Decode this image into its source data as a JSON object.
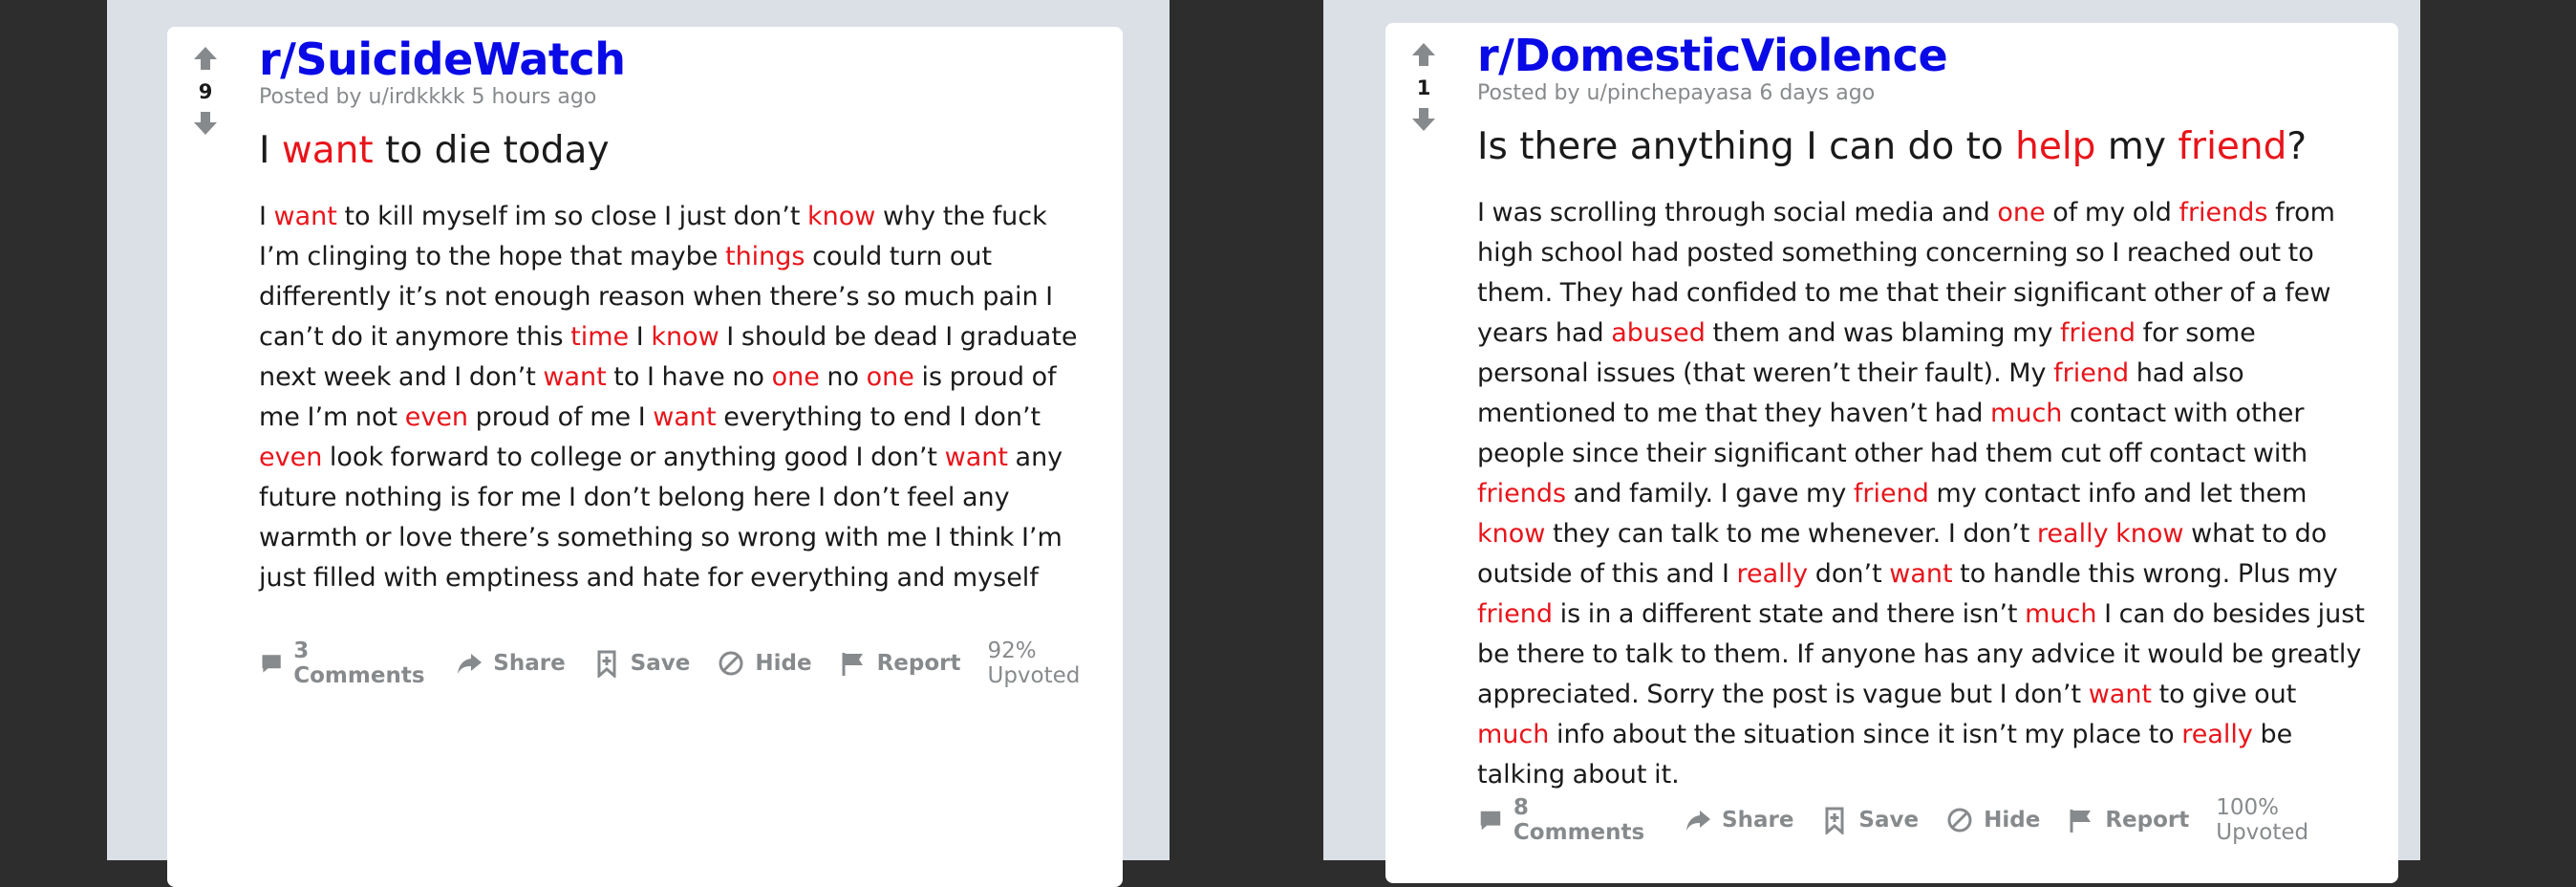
{
  "posts": [
    {
      "subreddit": "r/SuicideWatch",
      "meta": "Posted by u/irdkkkk 5 hours ago",
      "votes": "9",
      "title_segments": [
        {
          "t": "I ",
          "h": false
        },
        {
          "t": "want",
          "h": true
        },
        {
          "t": " to die today",
          "h": false
        }
      ],
      "body_segments": [
        {
          "t": "I ",
          "h": false
        },
        {
          "t": "want",
          "h": true
        },
        {
          "t": " to kill myself im so close I just don’t ",
          "h": false
        },
        {
          "t": "know",
          "h": true
        },
        {
          "t": " why the fuck I’m clinging to the hope that maybe ",
          "h": false
        },
        {
          "t": "things",
          "h": true
        },
        {
          "t": " could turn out differently it’s not enough reason when there’s so much pain I can’t do it anymore this ",
          "h": false
        },
        {
          "t": "time",
          "h": true
        },
        {
          "t": " I ",
          "h": false
        },
        {
          "t": "know",
          "h": true
        },
        {
          "t": " I should be dead I graduate next week and I don’t ",
          "h": false
        },
        {
          "t": "want",
          "h": true
        },
        {
          "t": " to I have no ",
          "h": false
        },
        {
          "t": "one",
          "h": true
        },
        {
          "t": " no ",
          "h": false
        },
        {
          "t": "one",
          "h": true
        },
        {
          "t": " is proud of me I’m not ",
          "h": false
        },
        {
          "t": "even",
          "h": true
        },
        {
          "t": " proud of me I ",
          "h": false
        },
        {
          "t": "want",
          "h": true
        },
        {
          "t": " everything to end I don’t ",
          "h": false
        },
        {
          "t": "even",
          "h": true
        },
        {
          "t": " look forward to college or anything good I don’t ",
          "h": false
        },
        {
          "t": "want",
          "h": true
        },
        {
          "t": " any future nothing is for me I don’t belong here I don’t feel any warmth or love there’s something so wrong with me I think I’m just filled with emptiness and hate for everything and myself",
          "h": false
        }
      ],
      "actions": {
        "comments": "3 Comments",
        "share": "Share",
        "save": "Save",
        "hide": "Hide",
        "report": "Report",
        "upvoted": "92% Upvoted"
      }
    },
    {
      "subreddit": "r/DomesticViolence",
      "meta": "Posted by u/pinchepayasa 6 days ago",
      "votes": "1",
      "title_segments": [
        {
          "t": "Is there anything I can do to ",
          "h": false
        },
        {
          "t": "help",
          "h": true
        },
        {
          "t": " my ",
          "h": false
        },
        {
          "t": "friend",
          "h": true
        },
        {
          "t": "?",
          "h": false
        }
      ],
      "body_segments": [
        {
          "t": "I was scrolling through social media and ",
          "h": false
        },
        {
          "t": "one",
          "h": true
        },
        {
          "t": " of my old ",
          "h": false
        },
        {
          "t": "friends",
          "h": true
        },
        {
          "t": " from high school had posted something concerning so I reached out to them. They had confided to me that their significant other of a few years had ",
          "h": false
        },
        {
          "t": "abused",
          "h": true
        },
        {
          "t": " them and was blaming my ",
          "h": false
        },
        {
          "t": "friend",
          "h": true
        },
        {
          "t": " for some personal issues (that weren’t their fault). My ",
          "h": false
        },
        {
          "t": "friend",
          "h": true
        },
        {
          "t": " had also mentioned to me that they haven’t had ",
          "h": false
        },
        {
          "t": "much",
          "h": true
        },
        {
          "t": " contact with other people since their significant other had them cut off contact with ",
          "h": false
        },
        {
          "t": "friends",
          "h": true
        },
        {
          "t": " and family. I gave my ",
          "h": false
        },
        {
          "t": "friend",
          "h": true
        },
        {
          "t": " my contact info and let them ",
          "h": false
        },
        {
          "t": "know",
          "h": true
        },
        {
          "t": " they can talk to me whenever. I don’t ",
          "h": false
        },
        {
          "t": "really know",
          "h": true
        },
        {
          "t": " what to do outside of this and I ",
          "h": false
        },
        {
          "t": "really",
          "h": true
        },
        {
          "t": " don’t ",
          "h": false
        },
        {
          "t": "want",
          "h": true
        },
        {
          "t": " to handle this wrong. Plus my ",
          "h": false
        },
        {
          "t": "friend",
          "h": true
        },
        {
          "t": " is in a different state and there isn’t ",
          "h": false
        },
        {
          "t": "much",
          "h": true
        },
        {
          "t": " I can do besides just be there to talk to them. If anyone has any advice it would be greatly appreciated. Sorry the post is vague but I don’t ",
          "h": false
        },
        {
          "t": "want",
          "h": true
        },
        {
          "t": " to give out ",
          "h": false
        },
        {
          "t": "much",
          "h": true
        },
        {
          "t": " info about the situation since it isn’t my place to ",
          "h": false
        },
        {
          "t": "really",
          "h": true
        },
        {
          "t": " be talking about it.",
          "h": false
        }
      ],
      "actions": {
        "comments": "8 Comments",
        "share": "Share",
        "save": "Save",
        "hide": "Hide",
        "report": "Report",
        "upvoted": "100% Upvoted"
      }
    }
  ],
  "colors": {
    "subreddit": "#0a0ae6",
    "highlight": "#e8141a",
    "panel_bg": "#dae0e6",
    "outer_bg": "#2d2d2d",
    "muted": "#878a8c"
  },
  "icons": [
    "upvote-arrow-icon",
    "downvote-arrow-icon",
    "comment-icon",
    "share-icon",
    "save-icon",
    "hide-icon",
    "report-icon"
  ]
}
